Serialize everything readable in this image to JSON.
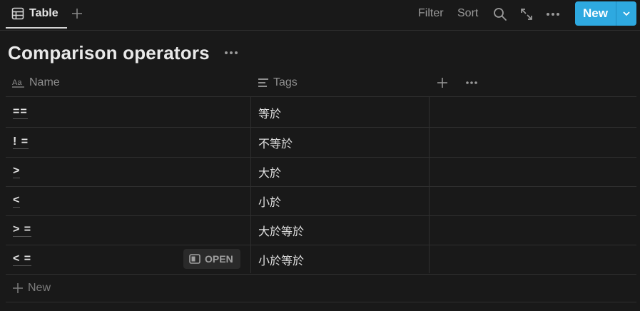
{
  "tabs": [
    {
      "label": "Table"
    }
  ],
  "toolbar": {
    "filter_label": "Filter",
    "sort_label": "Sort",
    "new_label": "New"
  },
  "page": {
    "title": "Comparison operators"
  },
  "columns": [
    {
      "label": "Name",
      "icon": "text-type-icon"
    },
    {
      "label": "Tags",
      "icon": "list-lines-icon"
    }
  ],
  "rows": [
    {
      "name": "==",
      "tags": "等於"
    },
    {
      "name": "! =",
      "tags": "不等於"
    },
    {
      "name": ">",
      "tags": "大於"
    },
    {
      "name": "<",
      "tags": "小於"
    },
    {
      "name": "> =",
      "tags": "大於等於"
    },
    {
      "name": "< =",
      "tags": "小於等於",
      "hovered": true
    }
  ],
  "open_badge": {
    "label": "OPEN"
  },
  "add_row": {
    "label": "New"
  },
  "colors": {
    "background": "#191919",
    "accent": "#2ea9e0",
    "text": "#d4d4d4",
    "muted": "#8f8f8f",
    "border": "#2f2f2f"
  }
}
